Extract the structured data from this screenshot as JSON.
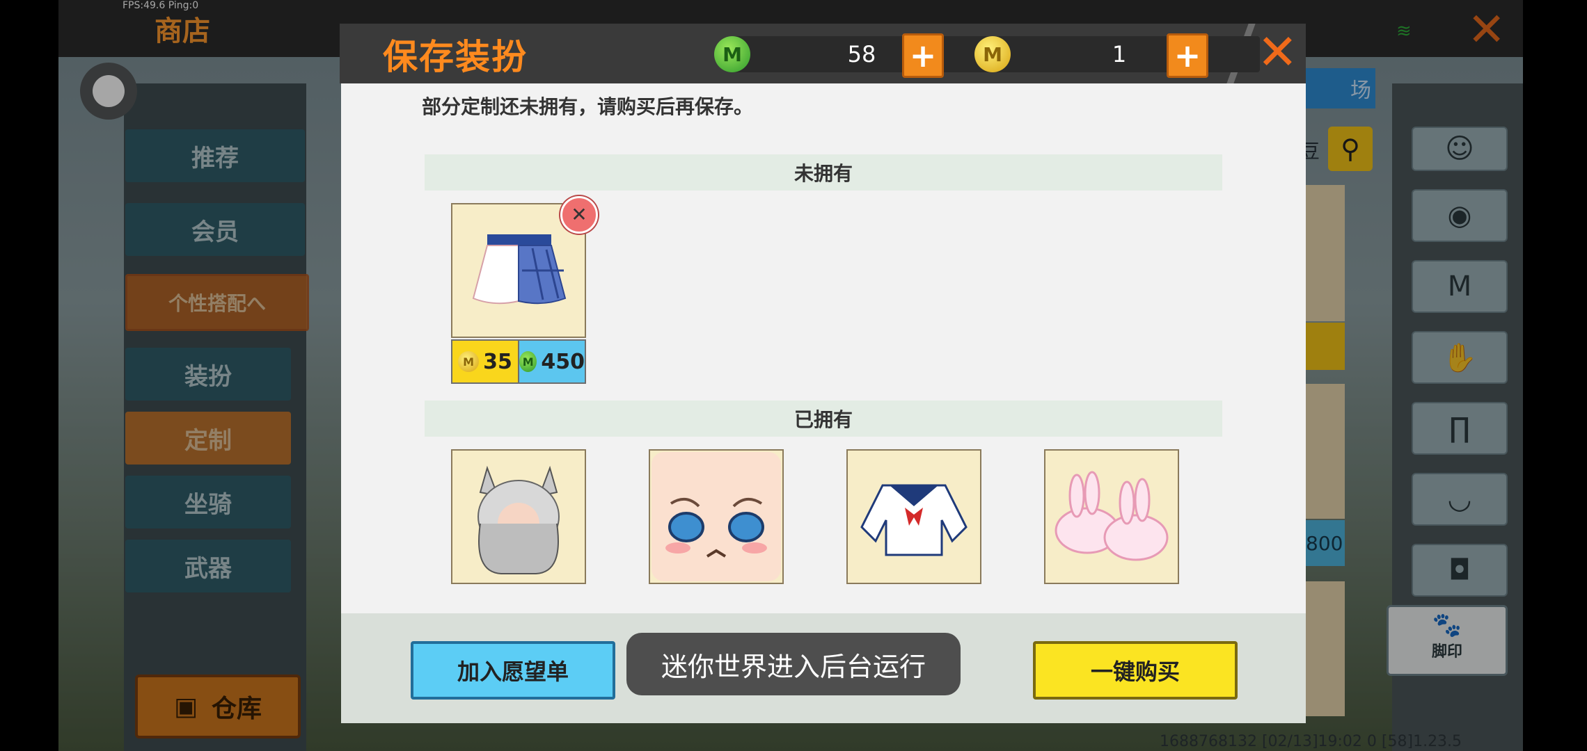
{
  "status": {
    "fps": "FPS:49.6  Ping:0"
  },
  "shop": {
    "title": "商店"
  },
  "sidebar": {
    "items": [
      {
        "label": "推荐"
      },
      {
        "label": "会员"
      },
      {
        "label": "个性搭配へ"
      },
      {
        "label": "装扮"
      },
      {
        "label": "定制"
      },
      {
        "label": "坐骑"
      },
      {
        "label": "武器"
      }
    ],
    "warehouse": "仓库"
  },
  "behind": {
    "tab_fragment": "场",
    "search_fragment": "豆",
    "price_fragment": "800"
  },
  "right_panel": {
    "footprint_label": "脚印"
  },
  "modal": {
    "title": "保存装扮",
    "currency": {
      "green_amount": "58",
      "gold_amount": "1",
      "plus": "+"
    },
    "notice": "部分定制还未拥有，请购买后再保存。",
    "not_owned": {
      "header": "未拥有",
      "items": [
        {
          "name_icon": "skirt-icon",
          "gold_price": "35",
          "green_price": "450"
        }
      ]
    },
    "owned": {
      "header": "已拥有",
      "items": [
        {
          "icon": "cat-ear-hair-icon"
        },
        {
          "icon": "face-icon"
        },
        {
          "icon": "sailor-top-icon"
        },
        {
          "icon": "bunny-slippers-icon"
        }
      ]
    },
    "buttons": {
      "wishlist": "加入愿望单",
      "buy_all": "一键购买"
    },
    "toast": "迷你世界进入后台运行"
  },
  "footer_info": "1688768132   [02/13]19:02 0   [58]1.23.5",
  "colors": {
    "accent_orange": "#ff8a1e",
    "buy_yellow": "#fbe422",
    "wish_blue": "#5ccdf5",
    "green_currency": "#2e9a2c",
    "gold_currency": "#d8a411"
  }
}
